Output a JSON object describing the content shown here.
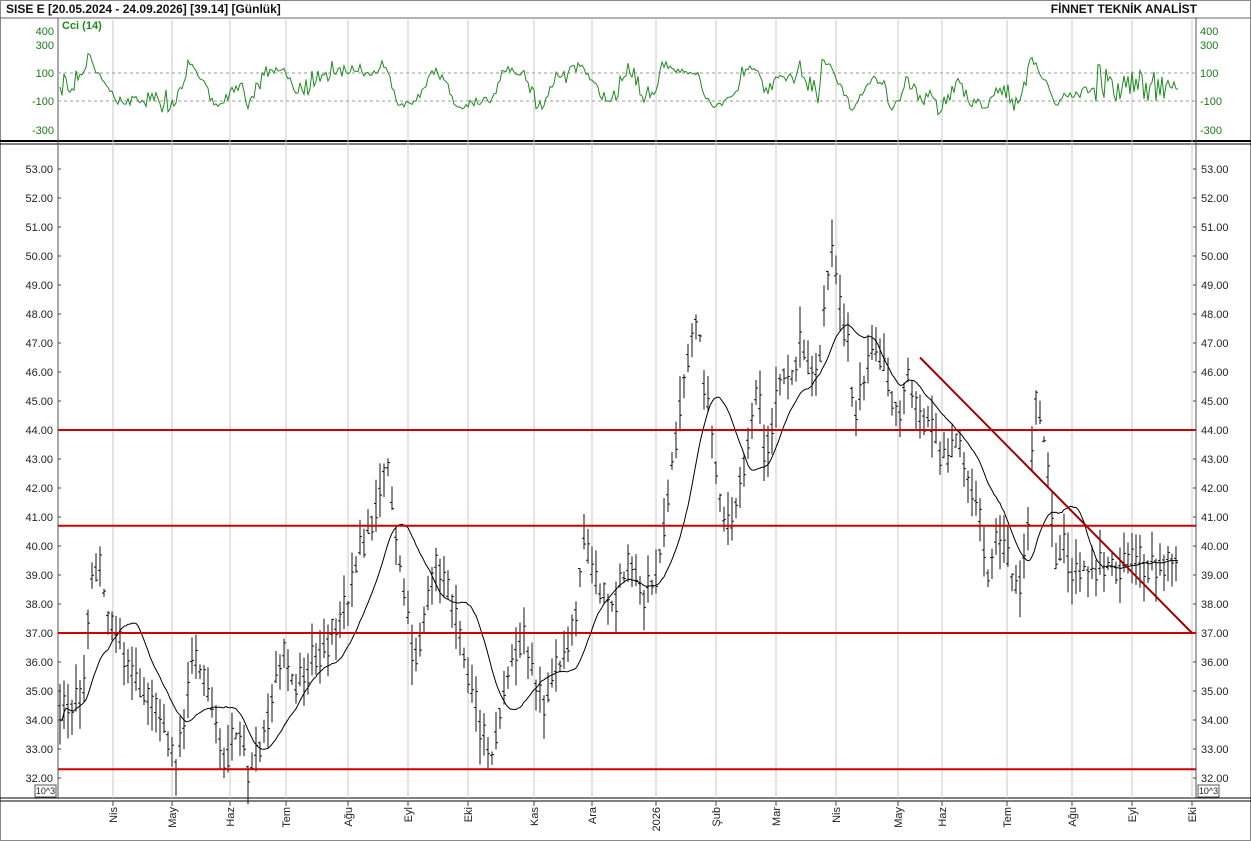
{
  "header": {
    "title": "SISE  E  [20.05.2024 - 24.09.2026]  [39.14]  [Günlük]",
    "brand": "FİNNET TEKNİK ANALİST"
  },
  "cci_panel": {
    "label": "Cci (14)",
    "ticks": [
      400,
      300,
      100,
      -100,
      -300
    ],
    "ylim": [
      -400,
      460
    ],
    "reference_lines": [
      100,
      -100
    ],
    "line_color": "#1e8a1e"
  },
  "scale_badge": "10^3",
  "chart_data": {
    "type": "bar",
    "subtype": "ohlc",
    "title": "",
    "ylim": [
      31.6,
      53.8
    ],
    "yticks": [
      53.0,
      52.0,
      51.0,
      50.0,
      49.0,
      48.0,
      47.0,
      46.0,
      45.0,
      44.0,
      43.0,
      42.0,
      41.0,
      40.0,
      39.0,
      38.0,
      37.0,
      36.0,
      35.0,
      34.0,
      33.0,
      32.0
    ],
    "ytick_labels": [
      "53.00",
      "52.00",
      "51.00",
      "50.00",
      "49.00",
      "48.00",
      "47.00",
      "46.00",
      "45.00",
      "44.00",
      "43.00",
      "42.00",
      "41.00",
      "40.00",
      "39.00",
      "38.00",
      "37.00",
      "36.00",
      "35.00",
      "34.00",
      "33.00",
      "32.00"
    ],
    "x_month_labels": [
      "Nis",
      "May",
      "Haz",
      "Tem",
      "Ağu",
      "Eyl",
      "Eki",
      "Kas",
      "Ara",
      "2026",
      "Şub",
      "Mar",
      "Nis",
      "May",
      "Haz",
      "Tem",
      "Ağu",
      "Eyl",
      "Eki"
    ],
    "grid": true,
    "horizontal_lines": [
      44.0,
      40.7,
      37.0,
      32.3
    ],
    "trendline": {
      "from": {
        "month_index": 13.5,
        "y": 46.5
      },
      "to": {
        "month_index": 18.0,
        "y": 37.0
      }
    },
    "moving_average_color": "#000000",
    "line_color": "#cc0000",
    "price_path": [
      [
        -0.5,
        34.6
      ],
      [
        -0.4,
        38.6
      ],
      [
        -0.25,
        39.5
      ],
      [
        -0.05,
        37.2
      ],
      [
        0.1,
        36.8
      ],
      [
        0.3,
        35.6
      ],
      [
        0.6,
        34.6
      ],
      [
        0.9,
        33.8
      ],
      [
        1.05,
        32.4
      ],
      [
        1.2,
        33.6
      ],
      [
        1.35,
        36.1
      ],
      [
        1.5,
        35.6
      ],
      [
        1.7,
        34.3
      ],
      [
        1.9,
        32.8
      ],
      [
        2.05,
        33.2
      ],
      [
        2.2,
        33.6
      ],
      [
        2.35,
        32.1
      ],
      [
        2.55,
        33.3
      ],
      [
        2.75,
        34.8
      ],
      [
        2.95,
        36.3
      ],
      [
        3.15,
        35.0
      ],
      [
        3.4,
        35.9
      ],
      [
        3.6,
        36.6
      ],
      [
        3.8,
        37.1
      ],
      [
        4.0,
        38.0
      ],
      [
        4.15,
        39.5
      ],
      [
        4.3,
        40.3
      ],
      [
        4.5,
        41.7
      ],
      [
        4.65,
        43.0
      ],
      [
        4.8,
        40.3
      ],
      [
        4.95,
        38.2
      ],
      [
        5.1,
        36.2
      ],
      [
        5.3,
        37.6
      ],
      [
        5.5,
        39.6
      ],
      [
        5.7,
        38.0
      ],
      [
        5.9,
        36.6
      ],
      [
        6.05,
        35.0
      ],
      [
        6.2,
        33.8
      ],
      [
        6.35,
        32.6
      ],
      [
        6.5,
        34.6
      ],
      [
        6.7,
        36.3
      ],
      [
        6.85,
        37.0
      ],
      [
        7.0,
        35.4
      ],
      [
        7.2,
        34.6
      ],
      [
        7.4,
        35.8
      ],
      [
        7.55,
        36.2
      ],
      [
        7.7,
        37.3
      ],
      [
        7.85,
        40.4
      ],
      [
        7.95,
        39.3
      ],
      [
        8.1,
        38.4
      ],
      [
        8.3,
        38.0
      ],
      [
        8.5,
        38.9
      ],
      [
        8.65,
        39.5
      ],
      [
        8.8,
        38.3
      ],
      [
        9.0,
        39.0
      ],
      [
        9.1,
        40.3
      ],
      [
        9.25,
        42.5
      ],
      [
        9.4,
        45.0
      ],
      [
        9.55,
        46.8
      ],
      [
        9.7,
        48.1
      ],
      [
        9.8,
        45.6
      ],
      [
        9.95,
        43.8
      ],
      [
        10.1,
        41.0
      ],
      [
        10.25,
        40.4
      ],
      [
        10.4,
        42.4
      ],
      [
        10.55,
        43.8
      ],
      [
        10.7,
        45.4
      ],
      [
        10.8,
        43.4
      ],
      [
        10.95,
        44.3
      ],
      [
        11.1,
        46.2
      ],
      [
        11.25,
        45.6
      ],
      [
        11.4,
        47.0
      ],
      [
        11.55,
        46.3
      ],
      [
        11.7,
        45.8
      ],
      [
        11.85,
        49.3
      ],
      [
        11.95,
        50.3
      ],
      [
        12.05,
        48.3
      ],
      [
        12.2,
        47.0
      ],
      [
        12.3,
        44.3
      ],
      [
        12.45,
        45.6
      ],
      [
        12.6,
        46.8
      ],
      [
        12.75,
        46.2
      ],
      [
        12.9,
        45.3
      ],
      [
        13.05,
        44.6
      ],
      [
        13.2,
        46.1
      ],
      [
        13.35,
        45.0
      ],
      [
        13.5,
        44.3
      ],
      [
        13.65,
        44.6
      ],
      [
        13.8,
        43.8
      ],
      [
        13.95,
        43.3
      ],
      [
        14.1,
        42.8
      ],
      [
        14.25,
        43.6
      ],
      [
        14.4,
        42.3
      ],
      [
        14.55,
        41.4
      ],
      [
        14.7,
        39.0
      ],
      [
        14.85,
        40.3
      ],
      [
        15.0,
        39.5
      ],
      [
        15.15,
        38.4
      ],
      [
        15.3,
        40.0
      ],
      [
        15.45,
        45.2
      ],
      [
        15.6,
        43.2
      ],
      [
        15.75,
        39.2
      ],
      [
        15.9,
        40.0
      ],
      [
        16.0,
        39.1
      ]
    ]
  }
}
